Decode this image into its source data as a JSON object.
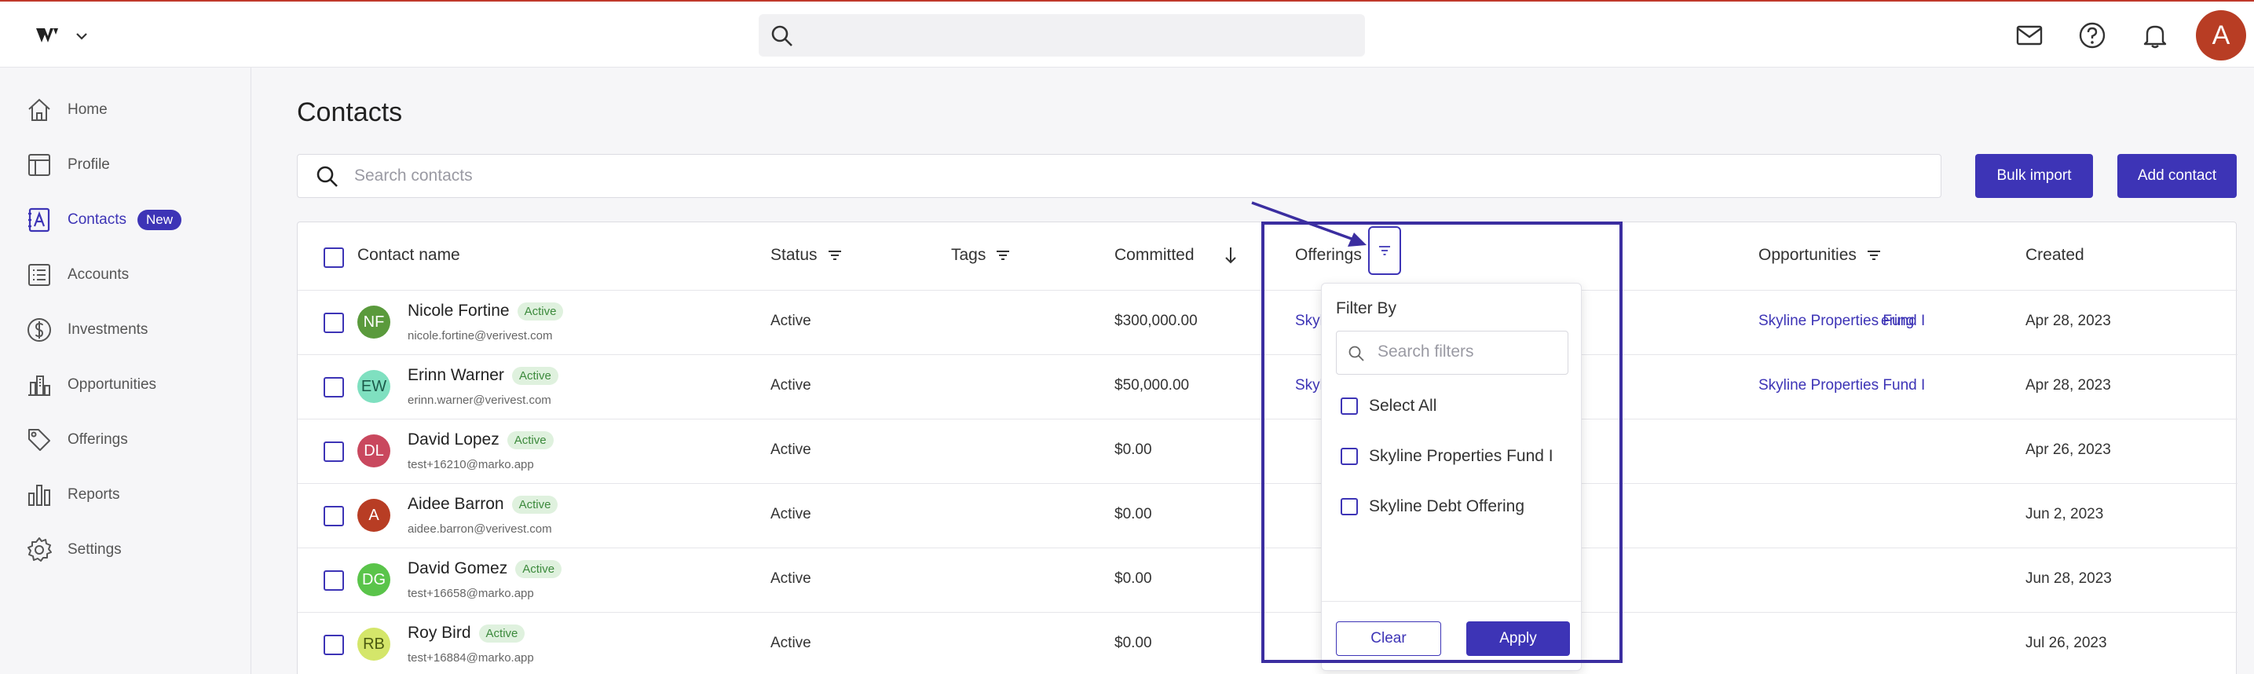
{
  "topbar": {
    "search_placeholder": "",
    "avatar_initial": "A",
    "icons": [
      "mail-icon",
      "help-icon",
      "bell-icon"
    ]
  },
  "sidebar": {
    "items": [
      {
        "label": "Home",
        "icon": "home-icon"
      },
      {
        "label": "Profile",
        "icon": "profile-icon"
      },
      {
        "label": "Contacts",
        "icon": "contacts-icon",
        "badge": "New",
        "active": true
      },
      {
        "label": "Accounts",
        "icon": "accounts-icon"
      },
      {
        "label": "Investments",
        "icon": "investments-icon"
      },
      {
        "label": "Opportunities",
        "icon": "opportunities-icon"
      },
      {
        "label": "Offerings",
        "icon": "offerings-icon"
      },
      {
        "label": "Reports",
        "icon": "reports-icon"
      },
      {
        "label": "Settings",
        "icon": "settings-icon"
      }
    ]
  },
  "main": {
    "title": "Contacts",
    "search_placeholder": "Search contacts",
    "bulk_import_label": "Bulk import",
    "add_contact_label": "Add contact"
  },
  "table": {
    "columns": {
      "name": "Contact name",
      "status": "Status",
      "tags": "Tags",
      "committed": "Committed",
      "offerings": "Offerings",
      "opportunities": "Opportunities",
      "created": "Created"
    },
    "rows": [
      {
        "initials": "NF",
        "avatar_color": "#5a9a3c",
        "name": "Nicole Fortine",
        "badge": "Active",
        "email": "nicole.fortine@verivest.com",
        "status": "Active",
        "committed": "$300,000.00",
        "offering_left": "Skyl",
        "offering_right": "ering",
        "opportunity": "Skyline Properties Fund I",
        "created": "Apr 28, 2023"
      },
      {
        "initials": "EW",
        "avatar_color": "#7fe0c0",
        "name": "Erinn Warner",
        "badge": "Active",
        "email": "erinn.warner@verivest.com",
        "status": "Active",
        "committed": "$50,000.00",
        "offering_left": "Skyl",
        "offering_right": "",
        "opportunity": "Skyline Properties Fund I",
        "created": "Apr 28, 2023"
      },
      {
        "initials": "DL",
        "avatar_color": "#c9485e",
        "name": "David Lopez",
        "badge": "Active",
        "email": "test+16210@marko.app",
        "status": "Active",
        "committed": "$0.00",
        "offering_left": "",
        "offering_right": "",
        "opportunity": "",
        "created": "Apr 26, 2023"
      },
      {
        "initials": "A",
        "avatar_color": "#b83d24",
        "name": "Aidee Barron",
        "badge": "Active",
        "email": "aidee.barron@verivest.com",
        "status": "Active",
        "committed": "$0.00",
        "offering_left": "",
        "offering_right": "",
        "opportunity": "",
        "created": "Jun 2, 2023"
      },
      {
        "initials": "DG",
        "avatar_color": "#5ac44a",
        "name": "David Gomez",
        "badge": "Active",
        "email": "test+16658@marko.app",
        "status": "Active",
        "committed": "$0.00",
        "offering_left": "",
        "offering_right": "",
        "opportunity": "",
        "created": "Jun 28, 2023"
      },
      {
        "initials": "RB",
        "avatar_color": "#d4e66a",
        "name": "Roy Bird",
        "badge": "Active",
        "email": "test+16884@marko.app",
        "status": "Active",
        "committed": "$0.00",
        "offering_left": "",
        "offering_right": "",
        "opportunity": "",
        "created": "Jul 26, 2023"
      }
    ]
  },
  "filter_dropdown": {
    "title": "Filter By",
    "search_placeholder": "Search filters",
    "options": [
      "Select All",
      "Skyline Properties Fund I",
      "Skyline Debt Offering"
    ],
    "clear_label": "Clear",
    "apply_label": "Apply"
  },
  "colors": {
    "accent": "#3d34b6",
    "annotation": "#3b2ea0",
    "active_badge_bg": "#dff1de",
    "active_badge_text": "#3c8a3c"
  }
}
